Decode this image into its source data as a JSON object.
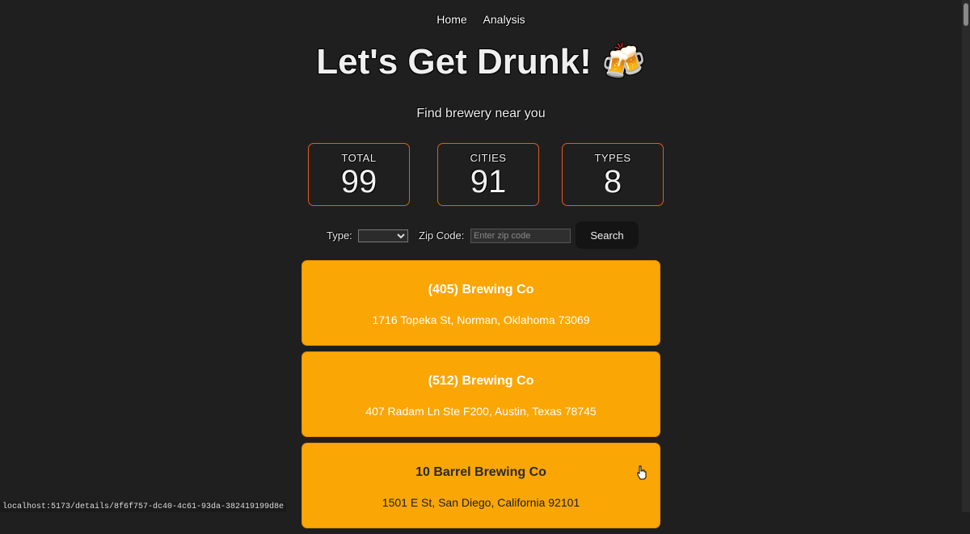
{
  "nav": {
    "items": [
      "Home",
      "Analysis"
    ]
  },
  "header": {
    "title": "Let's Get Drunk! 🍻",
    "subtitle": "Find brewery near you"
  },
  "stats": [
    {
      "label": "TOTAL",
      "value": "99"
    },
    {
      "label": "CITIES",
      "value": "91"
    },
    {
      "label": "TYPES",
      "value": "8"
    }
  ],
  "filters": {
    "type_label": "Type:",
    "type_selected": "",
    "zip_label": "Zip Code:",
    "zip_placeholder": "Enter zip code",
    "zip_value": "",
    "search_label": "Search"
  },
  "breweries": [
    {
      "name": "(405) Brewing Co",
      "address": "1716 Topeka St, Norman, Oklahoma 73069"
    },
    {
      "name": "(512) Brewing Co",
      "address": "407 Radam Ln Ste F200, Austin, Texas 78745"
    },
    {
      "name": "10 Barrel Brewing Co",
      "address": "1501 E St, San Diego, California 92101"
    }
  ],
  "statusbar": {
    "url": "localhost:5173/details/8f6f757-dc40-4c61-93da-382419199d8e"
  },
  "colors": {
    "card": "#faa605",
    "stat_border": "#e35b1f",
    "background": "#1f1f1f"
  }
}
